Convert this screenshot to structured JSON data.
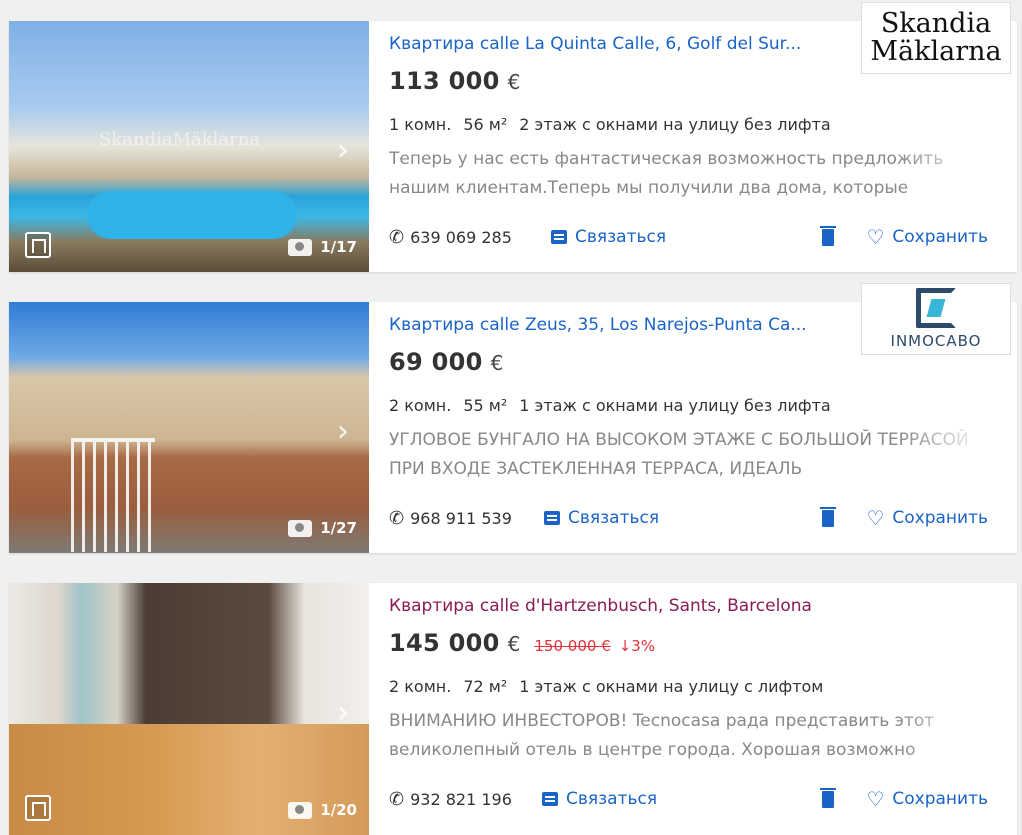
{
  "listings": [
    {
      "type": "Квартира",
      "street": "calle La Quinta Calle, 6, Golf del Sur...",
      "price": "113 000",
      "currency": "€",
      "rooms": "1 комн.",
      "area": "56 м²",
      "floor": "2 этаж с окнами на улицу без лифта",
      "description": "Теперь у нас есть фантастическая возможность предложить нашим клиентам.Теперь мы получили два дома, которые",
      "photo_count": "1/17",
      "phone": "639 069 285",
      "contact_label": "Связаться",
      "save_label": "Сохранить",
      "logo_text": "Skandia Mäklarna",
      "watermark": "SkandiaMäklarna"
    },
    {
      "type": "Квартира",
      "street": "calle Zeus, 35, Los Narejos-Punta Ca...",
      "price": "69 000",
      "currency": "€",
      "rooms": "2 комн.",
      "area": "55 м²",
      "floor": "1 этаж с окнами на улицу без лифта",
      "description": "УГЛОВОЕ БУНГАЛО НА ВЫСОКОМ ЭТАЖЕ С БОЛЬШОЙ ТЕРРАСОЙ ПРИ ВХОДЕ ЗАСТЕКЛЕННАЯ ТЕРРАСА, ИДЕАЛЬ",
      "photo_count": "1/27",
      "phone": "968 911 539",
      "contact_label": "Связаться",
      "save_label": "Сохранить",
      "logo_text": "INMOCABO"
    },
    {
      "type": "Квартира",
      "street": "calle d'Hartzenbusch, Sants, Barcelona",
      "price": "145 000",
      "currency": "€",
      "old_price": "150 000 €",
      "price_drop": "↓3%",
      "rooms": "2 комн.",
      "area": "72 м²",
      "floor": "1 этаж с окнами на улицу с лифтом",
      "description": "ВНИМАНИЮ ИНВЕСТОРОВ! Tecnocasa рада представить этот великолепный отель в центре города. Хорошая возможно",
      "photo_count": "1/20",
      "phone": "932 821 196",
      "contact_label": "Связаться",
      "save_label": "Сохранить"
    }
  ],
  "icons": {
    "next": "chevron-right-icon",
    "camera": "camera-icon",
    "phone": "phone-icon",
    "chat": "chat-icon",
    "trash": "trash-icon",
    "heart": "heart-icon",
    "plan": "floor-plan-icon"
  },
  "colors": {
    "link": "#1a64c7",
    "visited": "#8a1b55",
    "price_drop": "#e0343a"
  }
}
